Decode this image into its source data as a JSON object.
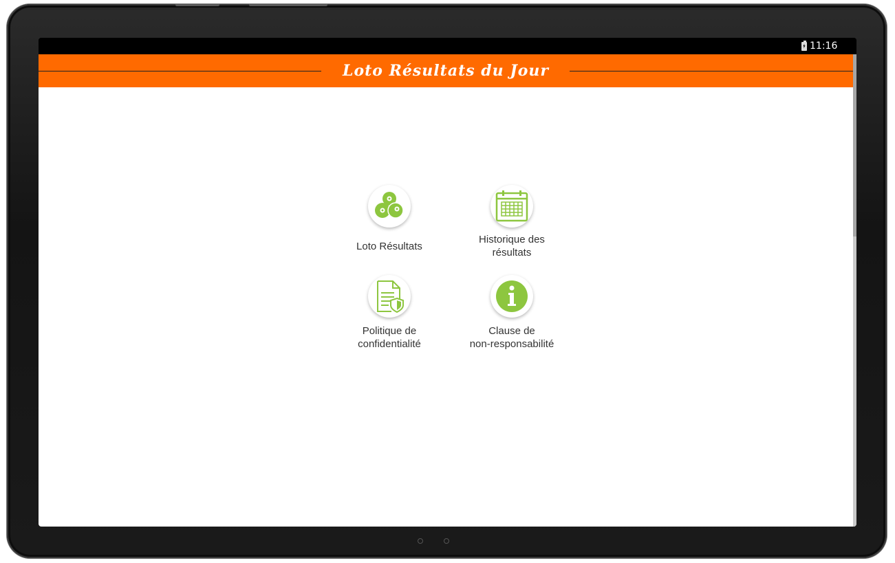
{
  "status_bar": {
    "time": "11:16"
  },
  "header": {
    "title": "Loto Résultats du Jour",
    "background_color": "#ff6a00"
  },
  "menu": {
    "accent_color": "#8dc63f",
    "items": [
      {
        "label": "Loto Résultats",
        "icon": "lottery-balls-icon"
      },
      {
        "label": "Historique des\nrésultats",
        "icon": "calendar-icon"
      },
      {
        "label": "Politique de\nconfidentialité",
        "icon": "privacy-document-icon"
      },
      {
        "label": "Clause de\nnon-responsabilité",
        "icon": "info-icon"
      }
    ]
  }
}
